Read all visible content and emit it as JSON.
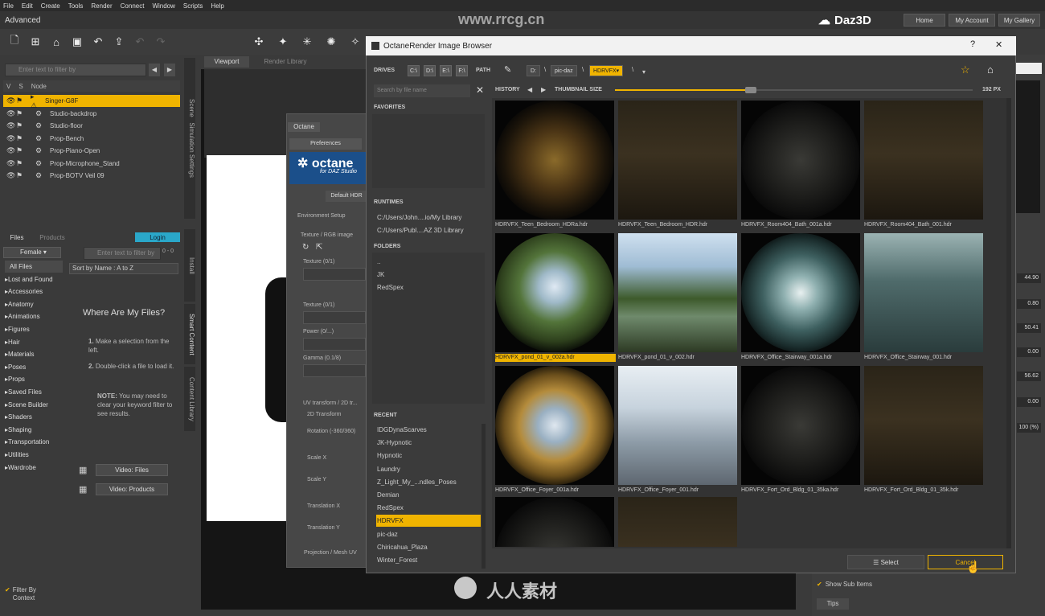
{
  "menubar": [
    "File",
    "Edit",
    "Create",
    "Tools",
    "Render",
    "Connect",
    "Window",
    "Scripts",
    "Help"
  ],
  "layout_label": "Advanced",
  "brand": {
    "name": "Daz3D",
    "home": "Home",
    "account": "My Account",
    "gallery": "My Gallery"
  },
  "scene": {
    "filter_placeholder": "Enter text to filter by",
    "col_v": "V",
    "col_s": "S",
    "col_node": "Node",
    "nodes": [
      "Singer-G8F",
      "Studio-backdrop",
      "Studio-floor",
      "Prop-Bench",
      "Prop-Piano-Open",
      "Prop-Microphone_Stand",
      "Prop-BOTV Veil 09"
    ],
    "tab_scene": "Scene",
    "tab_sim": "Simulation Settings"
  },
  "content": {
    "tab_files": "Files",
    "tab_products": "Products",
    "login": "Login",
    "gender_select": "Female",
    "filter_placeholder": "Enter text to filter by",
    "count": "0 - 0",
    "sort": "Sort by Name : A to Z",
    "categories": [
      "All Files",
      "Lost and Found",
      "Accessories",
      "Anatomy",
      "Animations",
      "Figures",
      "Hair",
      "Materials",
      "Poses",
      "Props",
      "Saved Files",
      "Scene Builder",
      "Shaders",
      "Shaping",
      "Transportation",
      "Utilities",
      "Wardrobe"
    ],
    "where_title": "Where Are My Files?",
    "step1_num": "1.",
    "step1": "Make a selection from the left.",
    "step2_num": "2.",
    "step2": "Double-click a file to load it.",
    "note_bold": "NOTE:",
    "note": "You may need to clear your keyword filter to see results.",
    "video_files": "Video: Files",
    "video_products": "Video: Products",
    "filter_by_context": "Filter By Context",
    "tab_install": "Install",
    "tab_smart": "Smart Content",
    "tab_library": "Content Library"
  },
  "viewport": {
    "tab_viewport": "Viewport",
    "tab_render": "Render Library"
  },
  "octane": {
    "tab": "Octane",
    "preferences": "Preferences",
    "logo": "octane",
    "logo_sub": "for DAZ Studio",
    "default_hdr": "Default HDR",
    "env_setup": "Environment Setup",
    "texture_rgb": "Texture / RGB image",
    "texture1": "Texture (0/1)",
    "texture2": "Texture (0/1)",
    "power": "Power (0/...)",
    "gamma": "Gamma (0.1/8)",
    "uv_transform": "UV transform / 2D tr...",
    "transform2d": "2D Transform",
    "rotation": "Rotation (-360/360)",
    "scale_x": "Scale X",
    "scale_y": "Scale Y",
    "translation_x": "Translation X",
    "translation_y": "Translation Y",
    "projection": "Projection / Mesh UV"
  },
  "right_values": [
    "44.90",
    "0.80",
    "50.41",
    "0.00",
    "56.62",
    "0.00",
    "100 (%)"
  ],
  "right_bottom": {
    "show_sub_items": "Show Sub Items",
    "tips": "Tips"
  },
  "dialog": {
    "title": "OctaneRender Image Browser",
    "help": "?",
    "close": "✕",
    "drives_label": "DRIVES",
    "drives": [
      "C:\\",
      "D:\\",
      "E:\\",
      "F:\\"
    ],
    "path_label": "PATH",
    "path": [
      "D:",
      "pic-daz",
      "HDRVFX"
    ],
    "search_placeholder": "Search by file name",
    "history_label": "HISTORY",
    "thumb_size_label": "THUMBNAIL SIZE",
    "thumb_size_value": "192 PX",
    "favorites_label": "FAVORITES",
    "runtimes_label": "RUNTIMES",
    "runtimes": [
      "C:/Users/John....io/My Library",
      "C:/Users/Publ....AZ 3D Library"
    ],
    "folders_label": "FOLDERS",
    "folders": [
      "..",
      "JK",
      "RedSpex"
    ],
    "recent_label": "RECENT",
    "recent": [
      "IDGDynaScarves",
      "JK-Hypnotic",
      "Hypnotic",
      "Laundry",
      "Z_Light_My_...ndles_Poses",
      "Demian",
      "RedSpex",
      "HDRVFX",
      "pic-daz",
      "Chiricahua_Plaza",
      "Winter_Forest"
    ],
    "recent_selected": 7,
    "thumbnails": [
      {
        "name": "HDRVFX_Teen_Bedroom_HDRa.hdr",
        "style": "sphere-dark"
      },
      {
        "name": "HDRVFX_Teen_Bedroom_HDR.hdr",
        "style": "flat-dark"
      },
      {
        "name": "HDRVFX_Room404_Bath_001a.hdr",
        "style": "sphere-black"
      },
      {
        "name": "HDRVFX_Room404_Bath_001.hdr",
        "style": "flat-dark"
      },
      {
        "name": "HDRVFX_pond_01_v_002a.hdr",
        "style": "sphere-green"
      },
      {
        "name": "HDRVFX_pond_01_v_002.hdr",
        "style": "flat-pond"
      },
      {
        "name": "HDRVFX_Office_Stairway_001a.hdr",
        "style": "sphere-teal"
      },
      {
        "name": "HDRVFX_Office_Stairway_001.hdr",
        "style": "flat-teal"
      },
      {
        "name": "HDRVFX_Office_Foyer_001a.hdr",
        "style": "sphere-gold"
      },
      {
        "name": "HDRVFX_Office_Foyer_001.hdr",
        "style": "flat-foyer"
      },
      {
        "name": "HDRVFX_Fort_Ord_Bldg_01_35ka.hdr",
        "style": "sphere-black"
      },
      {
        "name": "HDRVFX_Fort_Ord_Bldg_01_35k.hdr",
        "style": "flat-dark"
      },
      {
        "name": "",
        "style": "sphere-black"
      },
      {
        "name": "",
        "style": "flat-dark"
      }
    ],
    "selected_thumb": 4,
    "select_btn": "Select",
    "cancel_btn": "Cancel"
  },
  "watermark": {
    "site": "www.rrcg.cn",
    "text": "人人素材"
  }
}
